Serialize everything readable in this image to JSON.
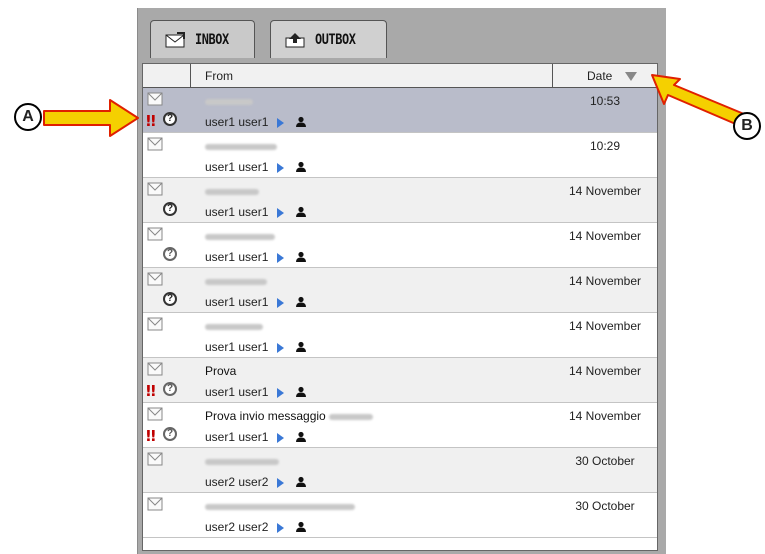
{
  "tabs": [
    {
      "label": "INBOX",
      "icon": "inbox-icon",
      "active": true
    },
    {
      "label": "OUTBOX",
      "icon": "outbox-icon",
      "active": false
    }
  ],
  "header": {
    "from_label": "From",
    "date_label": "Date"
  },
  "messages": [
    {
      "subject": "",
      "from": "user1 user1",
      "date": "10:53",
      "priority": "!!",
      "read_status": "q"
    },
    {
      "subject": "",
      "from": "user1 user1",
      "date": "10:29",
      "priority": "",
      "read_status": ""
    },
    {
      "subject": "",
      "from": "user1 user1",
      "date": "14 November",
      "priority": "",
      "read_status": "q"
    },
    {
      "subject": "",
      "from": "user1 user1",
      "date": "14 November",
      "priority": "",
      "read_status": "q-light"
    },
    {
      "subject": "",
      "from": "user1 user1",
      "date": "14 November",
      "priority": "",
      "read_status": "q"
    },
    {
      "subject": "",
      "from": "user1 user1",
      "date": "14 November",
      "priority": "",
      "read_status": ""
    },
    {
      "subject": "Prova",
      "from": "user1 user1",
      "date": "14 November",
      "priority": "!!",
      "read_status": "q-light"
    },
    {
      "subject": "Prova invio messaggio",
      "from": "user1 user1",
      "date": "14 November",
      "priority": "!!",
      "read_status": "q-light"
    },
    {
      "subject": "",
      "from": "user2 user2",
      "date": "30 October",
      "priority": "",
      "read_status": ""
    },
    {
      "subject": "",
      "from": "user2 user2",
      "date": "30 October",
      "priority": "",
      "read_status": ""
    }
  ],
  "callouts": {
    "a": "A",
    "b": "B"
  },
  "colors": {
    "selected_row": "#b9bcca",
    "priority": "#c00000",
    "arrow": "#f5d000",
    "play": "#3a78d6"
  }
}
